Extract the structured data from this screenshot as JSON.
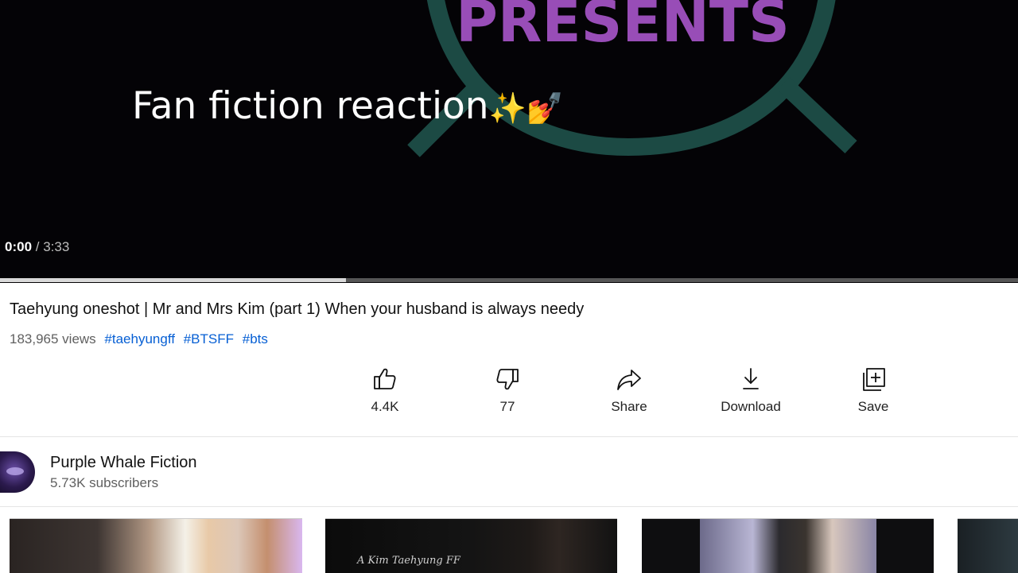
{
  "player": {
    "overlay_caption": "Fan fiction reaction",
    "overlay_emoji": "✨💅",
    "art_text": "PRESENTS",
    "current_time": "0:00",
    "duration": "/ 3:33",
    "buffered_fraction": 0.34
  },
  "video": {
    "title": "Taehyung oneshot | Mr and Mrs Kim (part 1) When your husband is always needy",
    "views": "183,965 views",
    "hashtags": [
      "#taehyungff",
      "#BTSFF",
      "#bts"
    ]
  },
  "actions": [
    {
      "icon": "thumbs-up-icon",
      "label": "4.4K"
    },
    {
      "icon": "thumbs-down-icon",
      "label": "77"
    },
    {
      "icon": "share-icon",
      "label": "Share"
    },
    {
      "icon": "download-icon",
      "label": "Download"
    },
    {
      "icon": "save-playlist-icon",
      "label": "Save"
    }
  ],
  "channel": {
    "name": "Purple Whale Fiction",
    "subscribers": "5.73K subscribers"
  },
  "thumbnails": [
    {
      "caption": ""
    },
    {
      "caption": "A Kim Taehyung FF"
    },
    {
      "caption": ""
    },
    {
      "caption": ""
    }
  ],
  "colors": {
    "player_bg": "#040306",
    "art_purple": "#b25ad6",
    "art_teal": "#1c4a44",
    "hashtag": "#065fd4",
    "meta_gray": "#606060"
  }
}
